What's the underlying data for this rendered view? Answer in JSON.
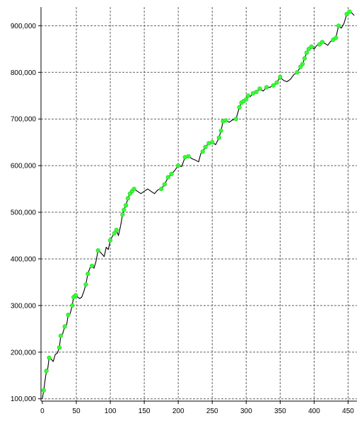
{
  "chart_data": {
    "type": "line",
    "title": "",
    "xlabel": "",
    "ylabel": "",
    "xlim": [
      -2,
      463
    ],
    "ylim": [
      95000,
      940000
    ],
    "x_ticks": [
      0,
      50,
      100,
      150,
      200,
      250,
      300,
      350,
      400,
      450
    ],
    "x_tick_labels": [
      "0",
      "50",
      "100",
      "150",
      "200",
      "250",
      "300",
      "350",
      "400",
      "450"
    ],
    "y_ticks": [
      100000,
      200000,
      300000,
      400000,
      500000,
      600000,
      700000,
      800000,
      900000
    ],
    "y_tick_labels": [
      "100,000",
      "200,000",
      "300,000",
      "400,000",
      "500,000",
      "600,000",
      "700,000",
      "800,000",
      "900,000"
    ],
    "grid": true,
    "colors": {
      "line": "#000000",
      "highs": "#33ff33",
      "grid": "#606060",
      "axis": "#000000"
    },
    "series": [
      {
        "values": [
          [
            0,
            100000
          ],
          [
            2,
            118000
          ],
          [
            4,
            140000
          ],
          [
            6,
            160000
          ],
          [
            8,
            165000
          ],
          [
            10,
            188000
          ],
          [
            13,
            185000
          ],
          [
            16,
            180000
          ],
          [
            19,
            195000
          ],
          [
            22,
            198000
          ],
          [
            25,
            210000
          ],
          [
            27,
            235000
          ],
          [
            30,
            240000
          ],
          [
            33,
            255000
          ],
          [
            36,
            260000
          ],
          [
            38,
            280000
          ],
          [
            41,
            283000
          ],
          [
            44,
            300000
          ],
          [
            46,
            318000
          ],
          [
            49,
            322000
          ],
          [
            52,
            318000
          ],
          [
            55,
            315000
          ],
          [
            58,
            318000
          ],
          [
            61,
            330000
          ],
          [
            64,
            345000
          ],
          [
            67,
            368000
          ],
          [
            70,
            380000
          ],
          [
            73,
            385000
          ],
          [
            76,
            380000
          ],
          [
            79,
            395000
          ],
          [
            82,
            418000
          ],
          [
            85,
            415000
          ],
          [
            88,
            410000
          ],
          [
            91,
            405000
          ],
          [
            94,
            425000
          ],
          [
            97,
            420000
          ],
          [
            100,
            440000
          ],
          [
            103,
            448000
          ],
          [
            106,
            455000
          ],
          [
            109,
            462000
          ],
          [
            112,
            450000
          ],
          [
            115,
            470000
          ],
          [
            118,
            495000
          ],
          [
            120,
            505000
          ],
          [
            123,
            515000
          ],
          [
            126,
            530000
          ],
          [
            129,
            540000
          ],
          [
            132,
            545000
          ],
          [
            135,
            550000
          ],
          [
            140,
            545000
          ],
          [
            145,
            540000
          ],
          [
            150,
            545000
          ],
          [
            155,
            550000
          ],
          [
            160,
            545000
          ],
          [
            165,
            540000
          ],
          [
            170,
            548000
          ],
          [
            175,
            550000
          ],
          [
            180,
            560000
          ],
          [
            185,
            575000
          ],
          [
            190,
            582000
          ],
          [
            195,
            590000
          ],
          [
            200,
            600000
          ],
          [
            205,
            598000
          ],
          [
            210,
            618000
          ],
          [
            215,
            620000
          ],
          [
            220,
            615000
          ],
          [
            225,
            612000
          ],
          [
            230,
            608000
          ],
          [
            233,
            625000
          ],
          [
            236,
            630000
          ],
          [
            240,
            640000
          ],
          [
            245,
            648000
          ],
          [
            250,
            650000
          ],
          [
            255,
            645000
          ],
          [
            260,
            660000
          ],
          [
            263,
            675000
          ],
          [
            266,
            695000
          ],
          [
            270,
            697000
          ],
          [
            275,
            693000
          ],
          [
            280,
            698000
          ],
          [
            285,
            700000
          ],
          [
            290,
            725000
          ],
          [
            293,
            735000
          ],
          [
            296,
            738000
          ],
          [
            300,
            742000
          ],
          [
            303,
            750000
          ],
          [
            306,
            748000
          ],
          [
            310,
            755000
          ],
          [
            315,
            758000
          ],
          [
            320,
            765000
          ],
          [
            325,
            760000
          ],
          [
            330,
            768000
          ],
          [
            335,
            768000
          ],
          [
            340,
            772000
          ],
          [
            345,
            778000
          ],
          [
            350,
            790000
          ],
          [
            353,
            785000
          ],
          [
            356,
            782000
          ],
          [
            360,
            780000
          ],
          [
            365,
            785000
          ],
          [
            370,
            795000
          ],
          [
            375,
            800000
          ],
          [
            380,
            812000
          ],
          [
            383,
            818000
          ],
          [
            386,
            830000
          ],
          [
            389,
            842000
          ],
          [
            392,
            850000
          ],
          [
            396,
            855000
          ],
          [
            400,
            850000
          ],
          [
            404,
            858000
          ],
          [
            408,
            860000
          ],
          [
            412,
            865000
          ],
          [
            416,
            862000
          ],
          [
            420,
            858000
          ],
          [
            424,
            866000
          ],
          [
            428,
            870000
          ],
          [
            432,
            874000
          ],
          [
            436,
            900000
          ],
          [
            440,
            895000
          ],
          [
            444,
            905000
          ],
          [
            448,
            925000
          ],
          [
            452,
            930000
          ],
          [
            455,
            928000
          ],
          [
            459,
            922000
          ]
        ]
      }
    ],
    "new_highs": [
      [
        2,
        118000
      ],
      [
        6,
        160000
      ],
      [
        10,
        188000
      ],
      [
        25,
        210000
      ],
      [
        27,
        235000
      ],
      [
        33,
        255000
      ],
      [
        38,
        280000
      ],
      [
        44,
        300000
      ],
      [
        46,
        318000
      ],
      [
        49,
        322000
      ],
      [
        64,
        345000
      ],
      [
        67,
        368000
      ],
      [
        73,
        385000
      ],
      [
        82,
        418000
      ],
      [
        100,
        440000
      ],
      [
        106,
        455000
      ],
      [
        109,
        462000
      ],
      [
        118,
        495000
      ],
      [
        120,
        505000
      ],
      [
        123,
        515000
      ],
      [
        126,
        530000
      ],
      [
        129,
        540000
      ],
      [
        132,
        545000
      ],
      [
        135,
        550000
      ],
      [
        175,
        550000
      ],
      [
        180,
        560000
      ],
      [
        185,
        575000
      ],
      [
        190,
        582000
      ],
      [
        200,
        600000
      ],
      [
        210,
        618000
      ],
      [
        215,
        620000
      ],
      [
        236,
        630000
      ],
      [
        240,
        640000
      ],
      [
        245,
        648000
      ],
      [
        250,
        650000
      ],
      [
        260,
        660000
      ],
      [
        263,
        675000
      ],
      [
        266,
        695000
      ],
      [
        270,
        697000
      ],
      [
        285,
        700000
      ],
      [
        290,
        725000
      ],
      [
        293,
        735000
      ],
      [
        296,
        738000
      ],
      [
        300,
        742000
      ],
      [
        303,
        750000
      ],
      [
        310,
        755000
      ],
      [
        315,
        758000
      ],
      [
        320,
        765000
      ],
      [
        330,
        768000
      ],
      [
        340,
        772000
      ],
      [
        345,
        778000
      ],
      [
        350,
        790000
      ],
      [
        375,
        800000
      ],
      [
        380,
        812000
      ],
      [
        383,
        818000
      ],
      [
        386,
        830000
      ],
      [
        389,
        842000
      ],
      [
        392,
        850000
      ],
      [
        396,
        855000
      ],
      [
        408,
        860000
      ],
      [
        412,
        865000
      ],
      [
        428,
        870000
      ],
      [
        432,
        874000
      ],
      [
        436,
        900000
      ],
      [
        448,
        925000
      ],
      [
        452,
        930000
      ]
    ]
  }
}
